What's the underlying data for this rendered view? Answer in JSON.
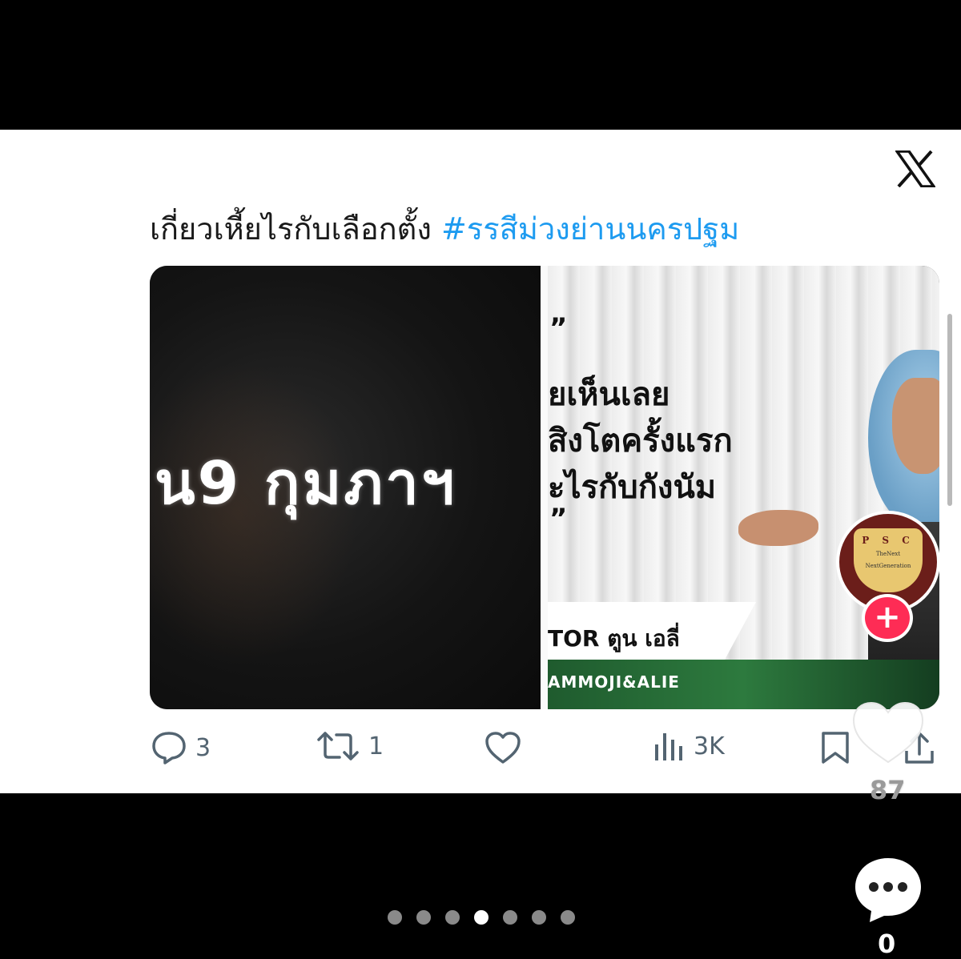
{
  "tweet": {
    "text": "เกี่ยวเหี้ยไรกับเลือกตั้ง ",
    "hashtag": "#รรสีม่วงย่านนครปฐม"
  },
  "media": {
    "left_caption": "น9 กุมภาฯ",
    "right_quote_open": "”",
    "right_lines": [
      "ยเห็นเลย",
      "สิงโตครั้งแรก",
      "ะไรกับกังนัม"
    ],
    "right_quote_close": "”",
    "lower_third_name": "TOR ตูน เอลี่",
    "green_bar_text": "AMMOJI&ALIE"
  },
  "badge": {
    "letters": "P S C",
    "sub_line1": "TheNext",
    "sub_line2": "NextGeneration",
    "plus": "+"
  },
  "actions": {
    "reply_count": "3",
    "retweet_count": "1",
    "views_count": "3K"
  },
  "overlay": {
    "like_count": "87",
    "comment_count": "0"
  },
  "carousel": {
    "total": 7,
    "active_index": 3
  },
  "colors": {
    "hashtag": "#1d9bf0",
    "action_gray": "#536471",
    "plus_red": "#fe2c55"
  }
}
